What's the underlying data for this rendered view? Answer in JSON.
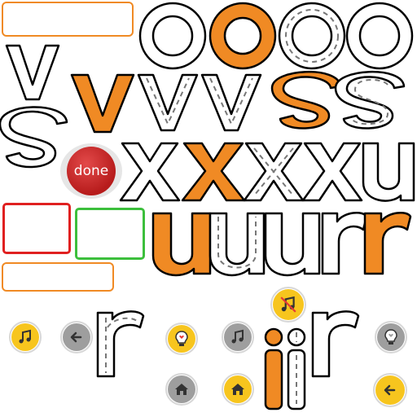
{
  "done_button": {
    "label": "done"
  },
  "colors": {
    "accent": "#f08a24",
    "outline": "#000000",
    "error_frame": "#e02020",
    "success_frame": "#3cbf3c",
    "done_red": "#c62828",
    "icon_gold": "#f7c51e",
    "icon_gray": "#9e9e9e"
  },
  "glyphs": [
    {
      "name": "letter-o-outline",
      "char": "o",
      "style": "outline"
    },
    {
      "name": "letter-o-orange",
      "char": "o",
      "style": "filled"
    },
    {
      "name": "letter-o-dashed-1",
      "char": "o",
      "style": "dashed"
    },
    {
      "name": "letter-o-dashed-2",
      "char": "o",
      "style": "outline"
    },
    {
      "name": "letter-v-outline",
      "char": "v",
      "style": "outline"
    },
    {
      "name": "letter-v-orange",
      "char": "v",
      "style": "filled"
    },
    {
      "name": "letter-v-outline-2",
      "char": "v",
      "style": "outline"
    },
    {
      "name": "letter-v-dashed",
      "char": "v",
      "style": "dashed"
    },
    {
      "name": "letter-v-dashed-2",
      "char": "v",
      "style": "dashed"
    },
    {
      "name": "letter-s-orange",
      "char": "s",
      "style": "filled"
    },
    {
      "name": "letter-s-dashed",
      "char": "s",
      "style": "dashed"
    },
    {
      "name": "letter-s-outline",
      "char": "s",
      "style": "outline"
    },
    {
      "name": "letter-x-outline",
      "char": "x",
      "style": "outline"
    },
    {
      "name": "letter-x-orange",
      "char": "x",
      "style": "filled"
    },
    {
      "name": "letter-x-dashed",
      "char": "x",
      "style": "dashed"
    },
    {
      "name": "letter-x-dashed-2",
      "char": "x",
      "style": "dashed"
    },
    {
      "name": "letter-u-outline",
      "char": "u",
      "style": "outline"
    },
    {
      "name": "letter-u-orange",
      "char": "u",
      "style": "filled"
    },
    {
      "name": "letter-u-dashed",
      "char": "u",
      "style": "dashed"
    },
    {
      "name": "letter-u-outline-2",
      "char": "u",
      "style": "outline"
    },
    {
      "name": "letter-r-outline",
      "char": "r",
      "style": "outline"
    },
    {
      "name": "letter-r-orange",
      "char": "r",
      "style": "filled"
    },
    {
      "name": "letter-r-dashed",
      "char": "r",
      "style": "dashed"
    },
    {
      "name": "letter-r-outline-2",
      "char": "r",
      "style": "outline"
    },
    {
      "name": "letter-i-orange",
      "char": "i",
      "style": "filled"
    },
    {
      "name": "letter-i-dashed",
      "char": "i",
      "style": "dashed"
    }
  ],
  "icons": [
    {
      "name": "music-note-gold-icon",
      "symbol": "music-note",
      "style": "gold"
    },
    {
      "name": "back-arrow-gray-icon",
      "symbol": "arrow-left",
      "style": "gray"
    },
    {
      "name": "hint-bulb-gold-icon",
      "symbol": "lightbulb-heart",
      "style": "gold"
    },
    {
      "name": "music-note-gray-icon",
      "symbol": "music-note",
      "style": "gray"
    },
    {
      "name": "music-muted-gold-icon",
      "symbol": "music-note-muted",
      "style": "gold"
    },
    {
      "name": "hint-bulb-gray-icon",
      "symbol": "lightbulb-heart",
      "style": "gray"
    },
    {
      "name": "home-gray-icon",
      "symbol": "home",
      "style": "gray"
    },
    {
      "name": "home-gold-icon",
      "symbol": "home",
      "style": "gold"
    },
    {
      "name": "back-arrow-gold-icon",
      "symbol": "arrow-left",
      "style": "gold"
    }
  ]
}
